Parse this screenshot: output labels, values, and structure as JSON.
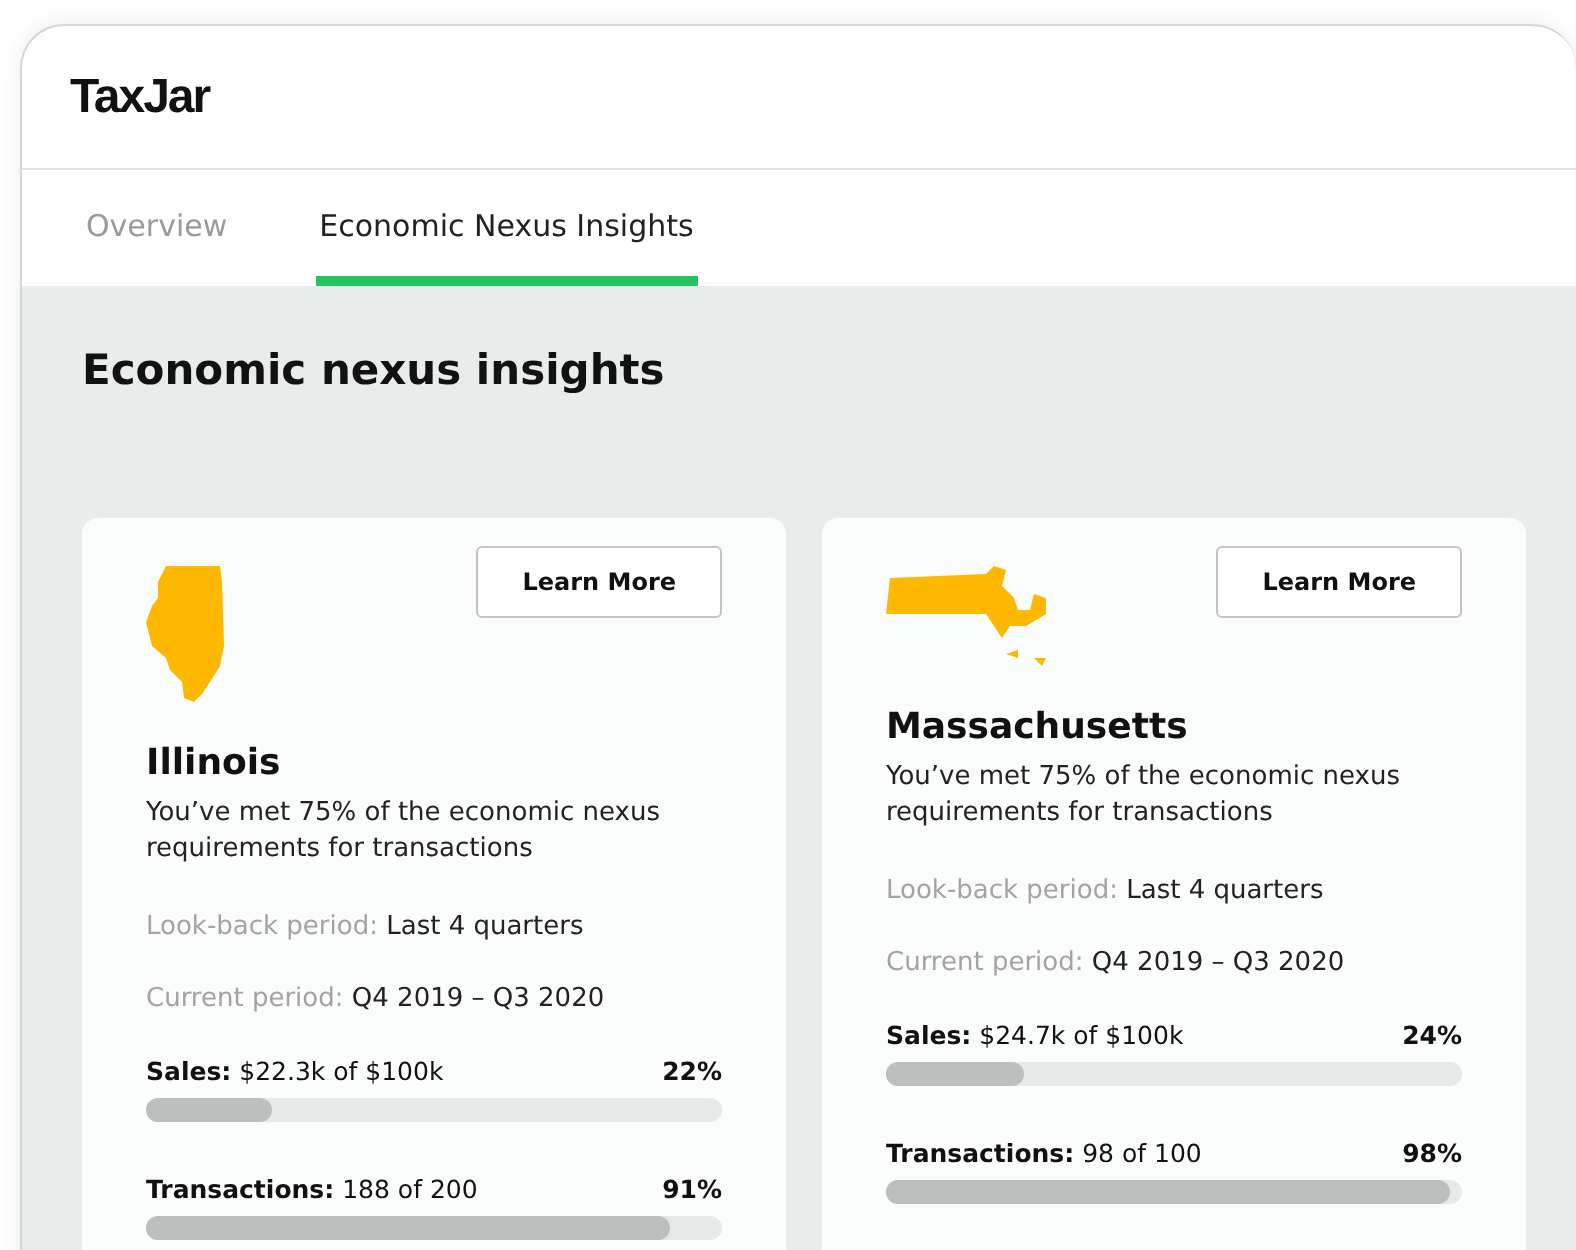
{
  "logo": "TaxJar",
  "tabs": [
    {
      "label": "Overview",
      "selected": false
    },
    {
      "label": "Economic Nexus Insights",
      "selected": true
    }
  ],
  "heading": "Economic nexus insights",
  "cards": [
    {
      "kind": "illinois",
      "button": "Learn More",
      "state": "Illinois",
      "summary": "You’ve met 75% of the economic nexus requirements for transactions",
      "lookback": {
        "label": "Look-back period:",
        "value": "Last 4 quarters"
      },
      "current": {
        "label": "Current period:",
        "value": "Q4 2019 – Q3 2020"
      },
      "metrics": [
        {
          "text": "**Sales:** $22.3k of $100k",
          "percent": "22%",
          "level": 0.22
        },
        {
          "text": "**Transactions:** 188 of 200",
          "percent": "91%",
          "level": 0.91
        }
      ]
    },
    {
      "kind": "massachusetts",
      "button": "Learn More",
      "state": "Massachusetts",
      "summary": "You’ve met 75% of the economic nexus requirements for transactions",
      "lookback": {
        "label": "Look-back period:",
        "value": "Last 4 quarters"
      },
      "current": {
        "label": "Current period:",
        "value": "Q4 2019 – Q3 2020"
      },
      "metrics": [
        {
          "text": "**Sales:** $24.7k of $100k",
          "percent": "24%",
          "level": 0.24
        },
        {
          "text": "**Transactions:** 98 of 100",
          "percent": "98%",
          "level": 0.98
        }
      ]
    }
  ]
}
